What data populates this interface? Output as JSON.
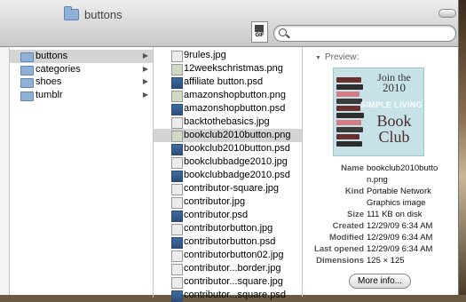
{
  "window": {
    "title": "buttons"
  },
  "toolbar": {
    "quicklook_badge": "GIF",
    "search_placeholder": ""
  },
  "sidebar_folders": [
    {
      "label": "buttons",
      "selected": true
    },
    {
      "label": "categories",
      "selected": false
    },
    {
      "label": "shoes",
      "selected": false
    },
    {
      "label": "tumblr",
      "selected": false
    }
  ],
  "files": [
    {
      "name": "9rules.jpg",
      "type": "jpg"
    },
    {
      "name": "12weekschristmas.png",
      "type": "png"
    },
    {
      "name": "affiliate button.psd",
      "type": "psd"
    },
    {
      "name": "amazonshopbutton.png",
      "type": "png"
    },
    {
      "name": "amazonshopbutton.psd",
      "type": "psd"
    },
    {
      "name": "backtothebasics.jpg",
      "type": "jpg"
    },
    {
      "name": "bookclub2010button.png",
      "type": "png",
      "selected": true
    },
    {
      "name": "bookclub2010button.psd",
      "type": "psd"
    },
    {
      "name": "bookclubbadge2010.jpg",
      "type": "jpg"
    },
    {
      "name": "bookclubbadge2010.psd",
      "type": "psd"
    },
    {
      "name": "contributor-square.jpg",
      "type": "jpg"
    },
    {
      "name": "contributor.jpg",
      "type": "jpg"
    },
    {
      "name": "contributor.psd",
      "type": "psd"
    },
    {
      "name": "contributorbutton.jpg",
      "type": "jpg"
    },
    {
      "name": "contributorbutton.psd",
      "type": "psd"
    },
    {
      "name": "contributorbutton02.jpg",
      "type": "jpg"
    },
    {
      "name": "contributor...border.jpg",
      "type": "jpg"
    },
    {
      "name": "contributor...square.jpg",
      "type": "jpg"
    },
    {
      "name": "contributor...square.psd",
      "type": "psd"
    }
  ],
  "preview": {
    "label": "Preview:",
    "image_text": {
      "line1": "Join the",
      "line2": "2010",
      "line3": "SIMPLE LIVING",
      "line4": "Book",
      "line5": "Club"
    },
    "meta": [
      {
        "key": "Name",
        "value": "bookclub2010butto"
      },
      {
        "key": "",
        "value": "n.png"
      },
      {
        "key": "Kind",
        "value": "Portable Network"
      },
      {
        "key": "",
        "value": "Graphics image"
      },
      {
        "key": "Size",
        "value": "111 KB on disk"
      },
      {
        "key": "Created",
        "value": "12/29/09 6:34 AM"
      },
      {
        "key": "Modified",
        "value": "12/29/09 6:34 AM"
      },
      {
        "key": "Last opened",
        "value": "12/29/09 6:34 AM"
      },
      {
        "key": "Dimensions",
        "value": "125 × 125"
      }
    ],
    "more_info_label": "More info..."
  },
  "icons": {
    "title_folder": "folder-icon",
    "search": "search-icon",
    "disclosure": "triangle-down-icon",
    "row_arrow": "chevron-right-icon"
  },
  "colors": {
    "selection": "#d4d4d4",
    "folder": "#8fb1d6",
    "preview_bg": "#c6e2e6"
  }
}
